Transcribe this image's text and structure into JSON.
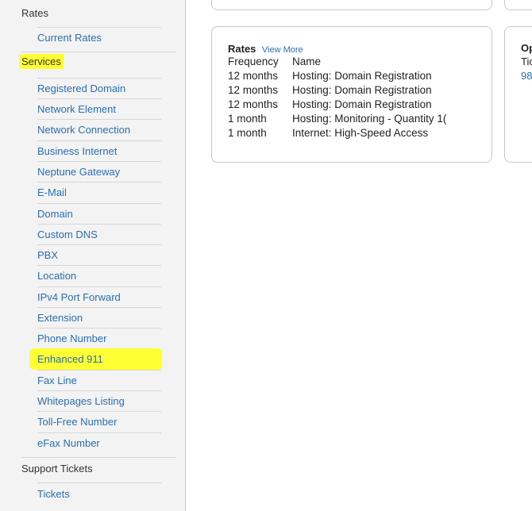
{
  "sidebar": {
    "rates": {
      "heading": "Rates",
      "items": [
        "Current Rates"
      ]
    },
    "services": {
      "heading": "Services",
      "items": [
        "Registered Domain",
        "Network Element",
        "Network Connection",
        "Business Internet",
        "Neptune Gateway",
        "E-Mail",
        "Domain",
        "Custom DNS",
        "PBX",
        "Location",
        "IPv4 Port Forward",
        "Extension",
        "Phone Number",
        "Enhanced 911",
        "Fax Line",
        "Whitepages Listing",
        "Toll-Free Number",
        "eFax Number"
      ]
    },
    "support": {
      "heading": "Support Tickets",
      "items": [
        "Tickets"
      ]
    }
  },
  "rates_card": {
    "title": "Rates",
    "view_more": "View More",
    "headers": [
      "Frequency",
      "Name"
    ],
    "rows": [
      [
        "12 months",
        "Hosting: Domain Registration"
      ],
      [
        "12 months",
        "Hosting: Domain Registration"
      ],
      [
        "12 months",
        "Hosting: Domain Registration"
      ],
      [
        "1 month",
        "Hosting: Monitoring - Quantity 1("
      ],
      [
        "1 month",
        "Internet: High-Speed Access"
      ]
    ]
  },
  "right_card": {
    "title_fragment": "Op",
    "line_fragment": "Tic",
    "link_fragment": "98"
  },
  "colors": {
    "link": "#2a6fb0",
    "highlight": "#ffff33",
    "sidebar_bg": "#f3f3f3"
  }
}
